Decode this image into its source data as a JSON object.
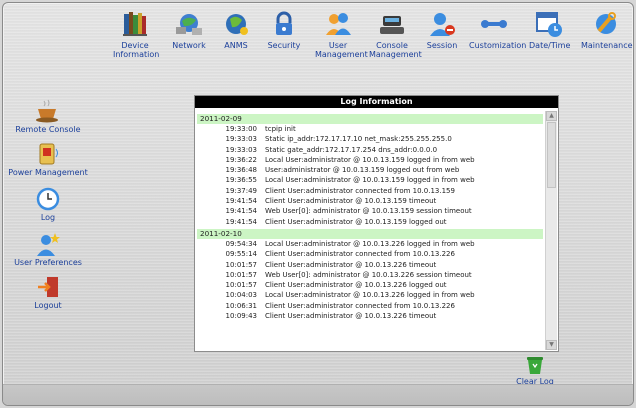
{
  "nav": {
    "items": [
      {
        "label": "Device Information",
        "l1": "Device",
        "l2": "Information"
      },
      {
        "label": "Network"
      },
      {
        "label": "ANMS"
      },
      {
        "label": "Security"
      },
      {
        "label": "User Management",
        "l1": "User",
        "l2": "Management"
      },
      {
        "label": "Console Management",
        "l1": "Console",
        "l2": "Management"
      },
      {
        "label": "Session"
      },
      {
        "label": "Customization"
      },
      {
        "label": "Date/Time"
      },
      {
        "label": "Maintenance"
      }
    ]
  },
  "sidebar": {
    "items": [
      {
        "label": "Remote Console"
      },
      {
        "label": "Power Management"
      },
      {
        "label": "Log"
      },
      {
        "label": "User Preferences"
      },
      {
        "label": "Logout"
      }
    ]
  },
  "log": {
    "title": "Log Information",
    "groups": [
      {
        "date": "2011-02-09",
        "entries": [
          {
            "time": "19:33:00",
            "msg": "tcpip init"
          },
          {
            "time": "19:33:03",
            "msg": "Static ip_addr:172.17.17.10 net_mask:255.255.255.0"
          },
          {
            "time": "19:33:03",
            "msg": "Static gate_addr:172.17.17.254 dns_addr:0.0.0.0"
          },
          {
            "time": "19:36:22",
            "msg": "Local User:administrator @ 10.0.13.159 logged in from web"
          },
          {
            "time": "19:36:48",
            "msg": "User:administrator @ 10.0.13.159 logged out from web"
          },
          {
            "time": "19:36:55",
            "msg": "Local User:administrator @ 10.0.13.159 logged in from web"
          },
          {
            "time": "19:37:49",
            "msg": "Client User:administrator connected from 10.0.13.159"
          },
          {
            "time": "19:41:54",
            "msg": "Client User:administrator @ 10.0.13.159 timeout"
          },
          {
            "time": "19:41:54",
            "msg": "Web User[0]: administrator @ 10.0.13.159 session timeout"
          },
          {
            "time": "19:41:54",
            "msg": "Client User:administrator @ 10.0.13.159 logged out"
          }
        ]
      },
      {
        "date": "2011-02-10",
        "entries": [
          {
            "time": "09:54:34",
            "msg": "Local User:administrator @ 10.0.13.226 logged in from web"
          },
          {
            "time": "09:55:14",
            "msg": "Client User:administrator connected from 10.0.13.226"
          },
          {
            "time": "10:01:57",
            "msg": "Client User:administrator @ 10.0.13.226 timeout"
          },
          {
            "time": "10:01:57",
            "msg": "Web User[0]: administrator @ 10.0.13.226 session timeout"
          },
          {
            "time": "10:01:57",
            "msg": "Client User:administrator @ 10.0.13.226 logged out"
          },
          {
            "time": "10:04:03",
            "msg": "Local User:administrator @ 10.0.13.226 logged in from web"
          },
          {
            "time": "10:06:31",
            "msg": "Client User:administrator connected from 10.0.13.226"
          },
          {
            "time": "10:09:43",
            "msg": "Client User:administrator @ 10.0.13.226 timeout"
          }
        ]
      }
    ]
  },
  "actions": {
    "clear_log": "Clear Log"
  },
  "colors": {
    "link": "#1b3f9a",
    "date_row": "#ccf5c4",
    "title_bar": "#000000"
  }
}
